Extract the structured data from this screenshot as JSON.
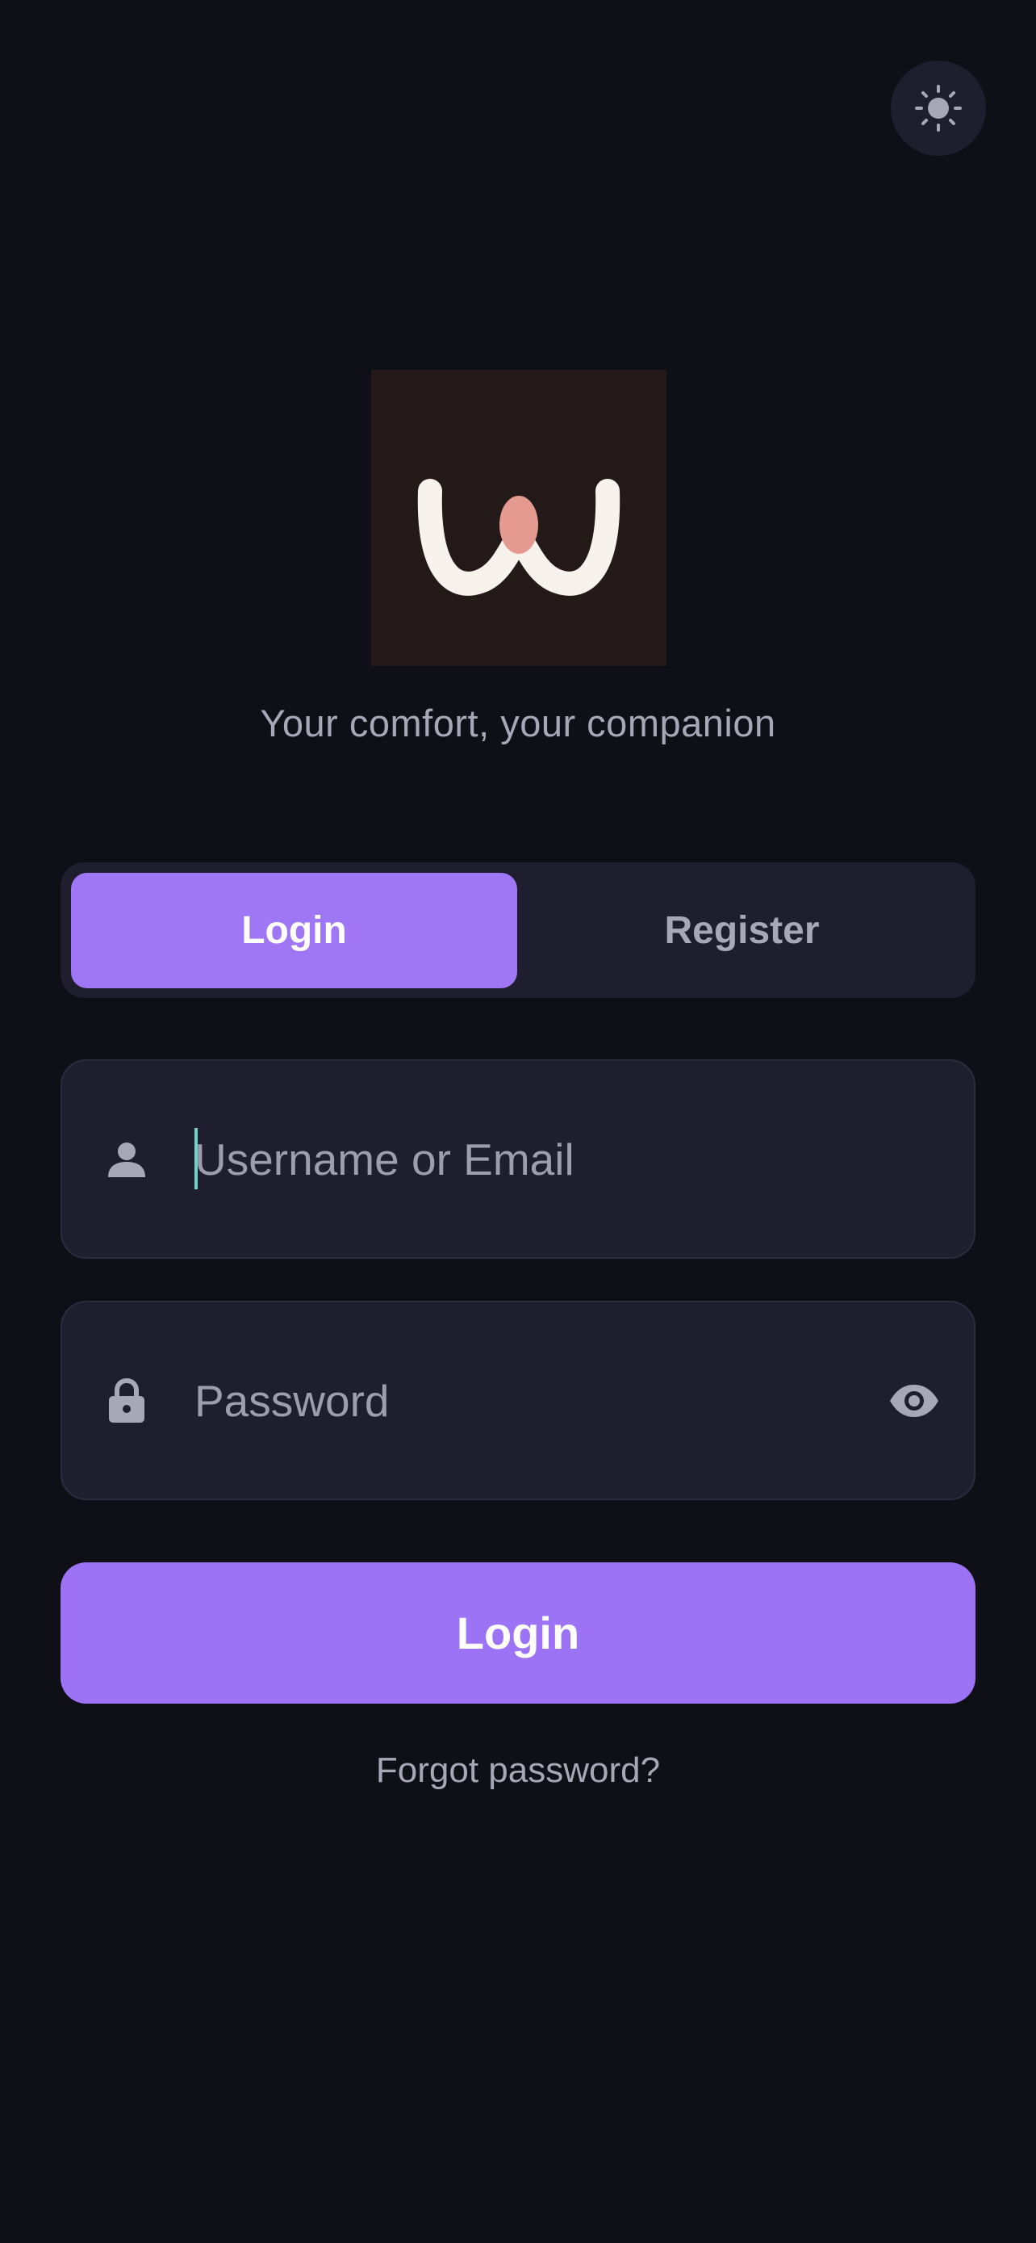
{
  "header": {
    "theme_toggle_icon": "sun-icon"
  },
  "brand": {
    "logo_icon": "app-logo",
    "tagline": "Your comfort, your companion"
  },
  "tabs": [
    {
      "label": "Login",
      "active": true
    },
    {
      "label": "Register",
      "active": false
    }
  ],
  "form": {
    "username": {
      "placeholder": "Username or Email",
      "value": "",
      "icon": "user-icon"
    },
    "password": {
      "placeholder": "Password",
      "value": "",
      "icon": "lock-icon",
      "toggle_icon": "eye-icon"
    },
    "submit_label": "Login",
    "forgot_label": "Forgot password?"
  },
  "colors": {
    "background": "#0f0f18",
    "surface": "#1e1e2e",
    "accent": "#9b73f4",
    "caret": "#6fd3c9",
    "muted_text": "#a7a7b6"
  }
}
